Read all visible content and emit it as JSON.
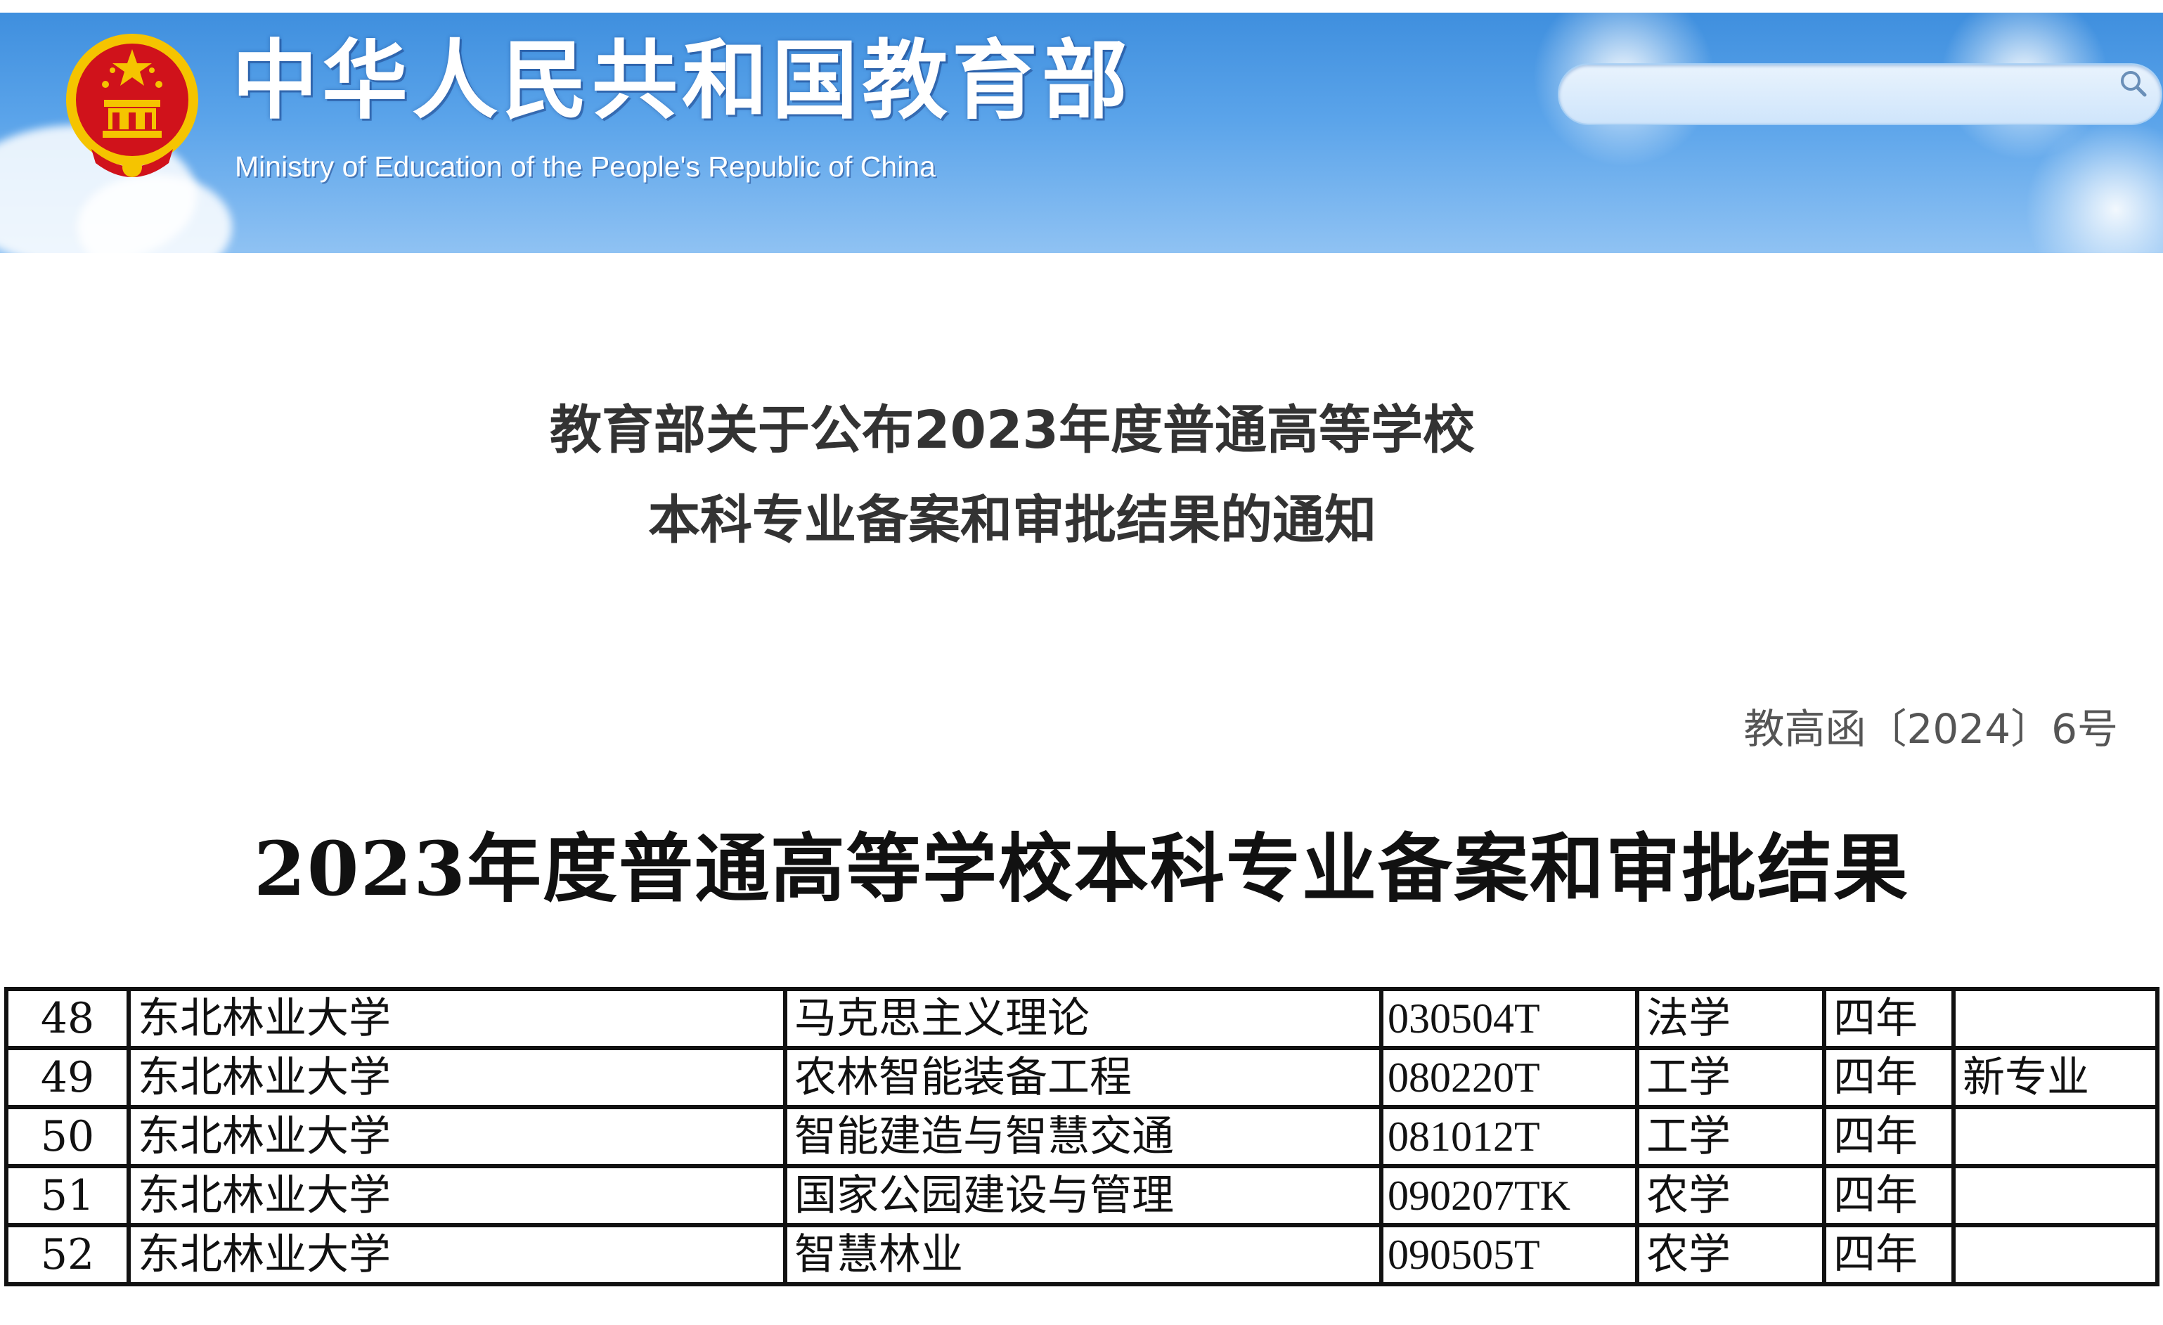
{
  "header": {
    "site_title_cn": "中华人民共和国教育部",
    "site_title_en": "Ministry of Education of the People's Republic of China",
    "search": {
      "placeholder": ""
    },
    "colors": {
      "banner_top": "#3f8fde",
      "banner_bottom": "#8fc2f3",
      "emblem_red": "#d0121b",
      "emblem_gold": "#f5c400"
    }
  },
  "notice": {
    "title_line1": "教育部关于公布2023年度普通高等学校",
    "title_line2": "本科专业备案和审批结果的通知",
    "doc_number": "教高函〔2024〕6号"
  },
  "attachment": {
    "title": "2023年度普通高等学校本科专业备案和审批结果"
  },
  "table": {
    "rows": [
      {
        "index": "48",
        "university": "东北林业大学",
        "major": "马克思主义理论",
        "code": "030504T",
        "discipline": "法学",
        "duration": "四年",
        "note": ""
      },
      {
        "index": "49",
        "university": "东北林业大学",
        "major": "农林智能装备工程",
        "code": "080220T",
        "discipline": "工学",
        "duration": "四年",
        "note": "新专业"
      },
      {
        "index": "50",
        "university": "东北林业大学",
        "major": "智能建造与智慧交通",
        "code": "081012T",
        "discipline": "工学",
        "duration": "四年",
        "note": ""
      },
      {
        "index": "51",
        "university": "东北林业大学",
        "major": "国家公园建设与管理",
        "code": "090207TK",
        "discipline": "农学",
        "duration": "四年",
        "note": ""
      },
      {
        "index": "52",
        "university": "东北林业大学",
        "major": "智慧林业",
        "code": "090505T",
        "discipline": "农学",
        "duration": "四年",
        "note": ""
      }
    ]
  }
}
